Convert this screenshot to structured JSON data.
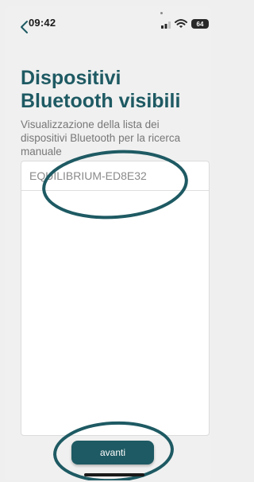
{
  "status_bar": {
    "time": "09:42",
    "battery": "64"
  },
  "page": {
    "title": "Dispositivi Bluetooth visibili",
    "subtitle": "Visualizzazione della lista dei dispositivi Bluetooth per la ricerca manuale"
  },
  "devices": [
    {
      "name": "EQUILIBRIUM-ED8E32"
    }
  ],
  "actions": {
    "next_label": "avanti"
  },
  "colors": {
    "brand": "#1e5a63",
    "background": "#f0f0f0",
    "annotation": "#1e5a63"
  },
  "icons": [
    "back-icon",
    "signal-icon",
    "wifi-icon",
    "battery-icon"
  ]
}
